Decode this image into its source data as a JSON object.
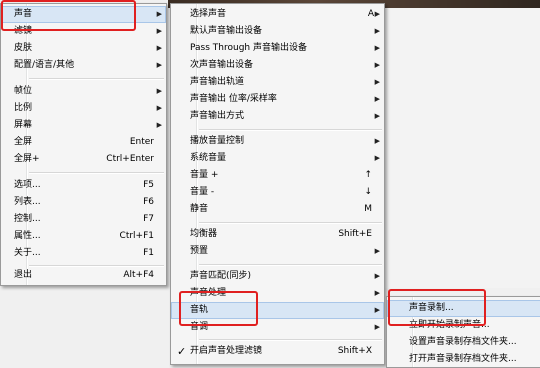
{
  "menu1": {
    "items": [
      {
        "label": "声音",
        "arrow": true
      },
      {
        "label": "滤镜",
        "arrow": true
      },
      {
        "label": "皮肤",
        "arrow": true
      },
      {
        "label": "配置/语言/其他",
        "arrow": true
      },
      {
        "sep": true
      },
      {
        "label": "帧位",
        "arrow": true
      },
      {
        "label": "比例",
        "arrow": true
      },
      {
        "label": "屏幕",
        "arrow": true
      },
      {
        "label": "全屏",
        "shortcut": "Enter"
      },
      {
        "label": "全屏+",
        "shortcut": "Ctrl+Enter"
      },
      {
        "sep": true
      },
      {
        "label": "选项...",
        "shortcut": "F5"
      },
      {
        "label": "列表...",
        "shortcut": "F6"
      },
      {
        "label": "控制...",
        "shortcut": "F7"
      },
      {
        "label": "属性...",
        "shortcut": "Ctrl+F1"
      },
      {
        "label": "关于...",
        "shortcut": "F1"
      },
      {
        "sep": true
      },
      {
        "label": "退出",
        "shortcut": "Alt+F4"
      }
    ]
  },
  "menu2": {
    "items": [
      {
        "label": "选择声音",
        "shortcut": "A",
        "arrow": true
      },
      {
        "label": "默认声音输出设备",
        "arrow": true
      },
      {
        "label": "Pass Through 声音输出设备",
        "arrow": true
      },
      {
        "label": "次声音输出设备",
        "arrow": true
      },
      {
        "label": "声音输出轨道",
        "arrow": true
      },
      {
        "label": "声音输出 位率/采样率",
        "arrow": true
      },
      {
        "label": "声音输出方式",
        "arrow": true
      },
      {
        "sep": true
      },
      {
        "label": "播放音量控制",
        "arrow": true
      },
      {
        "label": "系统音量",
        "arrow": true
      },
      {
        "label": "音量 +",
        "shortcut": "↑"
      },
      {
        "label": "音量 -",
        "shortcut": "↓"
      },
      {
        "label": "静音",
        "shortcut": "M"
      },
      {
        "sep": true
      },
      {
        "label": "均衡器",
        "shortcut": "Shift+E"
      },
      {
        "label": "预置",
        "arrow": true
      },
      {
        "sep": true
      },
      {
        "label": "声音匹配(同步)",
        "arrow": true
      },
      {
        "label": "声音处理",
        "arrow": true
      },
      {
        "label": "音轨",
        "arrow": true
      },
      {
        "label": "音调",
        "arrow": true
      },
      {
        "sep": true
      },
      {
        "label": "开启声音处理滤镜",
        "shortcut": "Shift+X",
        "checked": true
      }
    ]
  },
  "menu3": {
    "items": [
      {
        "label": "声音录制..."
      },
      {
        "label": "立即开始录制声音..."
      },
      {
        "label": "设置声音录制存档文件夹..."
      },
      {
        "label": "打开声音录制存档文件夹..."
      }
    ]
  },
  "glyphs": {
    "arrow": "▶",
    "check": "✓"
  },
  "highlight_color": "#e02020"
}
